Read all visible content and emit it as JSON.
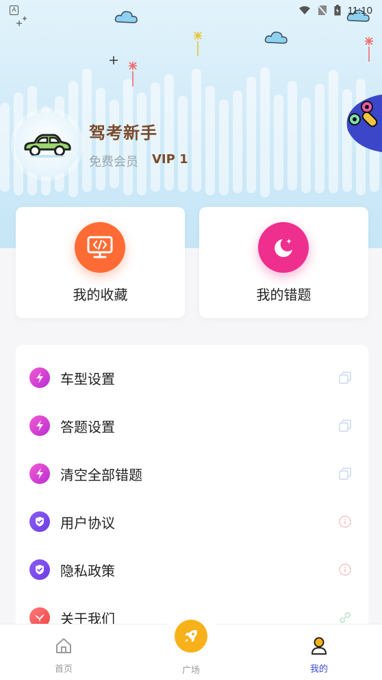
{
  "status_bar": {
    "time": "11:10"
  },
  "profile": {
    "name": "驾考新手",
    "tier": "免费会员",
    "vip": "VIP 1"
  },
  "quick_actions": [
    {
      "label": "我的收藏",
      "icon": "code-monitor-icon",
      "color": "#ff6b34"
    },
    {
      "label": "我的错题",
      "icon": "moon-icon",
      "color": "#ee2f8d"
    }
  ],
  "menu": [
    {
      "label": "车型设置",
      "left_icon": "bolt-icon",
      "right_icon": "copy-icon"
    },
    {
      "label": "答题设置",
      "left_icon": "bolt-icon",
      "right_icon": "copy-icon"
    },
    {
      "label": "清空全部错题",
      "left_icon": "bolt-icon",
      "right_icon": "copy-icon"
    },
    {
      "label": "用户协议",
      "left_icon": "shield-icon",
      "right_icon": "info-icon"
    },
    {
      "label": "隐私政策",
      "left_icon": "shield-icon",
      "right_icon": "info-icon"
    },
    {
      "label": "关于我们",
      "left_icon": "bird-icon",
      "right_icon": "link-icon"
    }
  ],
  "tabbar": {
    "home": "首页",
    "square": "广场",
    "mine": "我的"
  },
  "colors": {
    "brand_brown": "#7a4a2b",
    "active_tab": "#3a4bd0",
    "fab_yellow": "#f7b21a"
  }
}
